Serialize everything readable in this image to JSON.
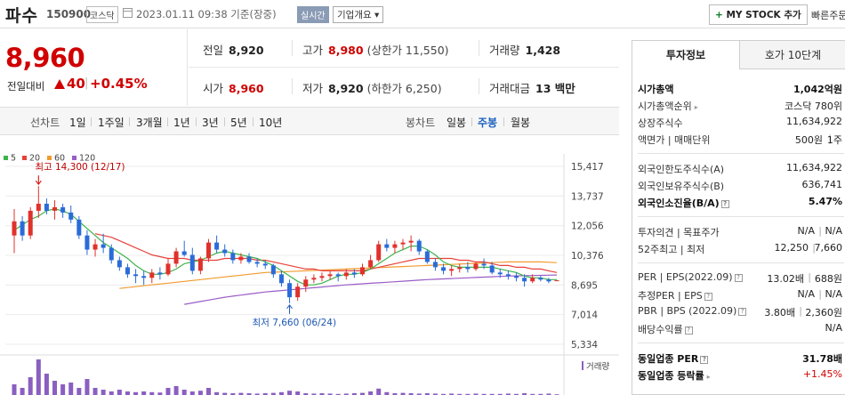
{
  "header": {
    "name": "파수",
    "code": "150900",
    "market": "코스닥",
    "datetime": "2023.01.11 09:38 기준(장중)",
    "realtime_badge": "실시간",
    "company_btn": "기업개요 ▾",
    "mystock_plus": "+",
    "mystock_label": " MY STOCK 추가",
    "quick_order": "빠른주문"
  },
  "price": {
    "current": "8,960",
    "change_label": "전일대비",
    "change_amount": "40",
    "change_sep": "|",
    "change_pct": "+0.45%",
    "direction": "up"
  },
  "quotes": {
    "prev_close_label": "전일",
    "prev_close": "8,920",
    "high_label": "고가",
    "high": "8,980",
    "high_sub": "(상한가 11,550)",
    "volume_label": "거래량",
    "volume": "1,428",
    "open_label": "시가",
    "open": "8,960",
    "low_label": "저가",
    "low": "8,920",
    "low_sub": "(하한가 6,250)",
    "amount_label": "거래대금",
    "amount": "13 백만"
  },
  "period_bar": {
    "line_chart": "선차트",
    "periods": [
      "1일",
      "1주일",
      "3개월",
      "1년",
      "3년",
      "5년",
      "10년"
    ],
    "candle_chart": "봉차트",
    "candle_types": [
      "일봉",
      "주봉",
      "월봉"
    ],
    "active_candle": "주봉"
  },
  "chart_data": {
    "type": "candlestick",
    "legend": [
      {
        "label": "5",
        "color": "#3cb44b"
      },
      {
        "label": "20",
        "color": "#e8413a"
      },
      {
        "label": "60",
        "color": "#f29b2f"
      },
      {
        "label": "120",
        "color": "#9a5cc8"
      }
    ],
    "y_ticks": [
      "15,417",
      "13,737",
      "12,056",
      "10,376",
      "8,695",
      "7,014",
      "5,334"
    ],
    "ylim": [
      5334,
      15417
    ],
    "high_annotation": "최고 14,300 (12/17)",
    "low_annotation": "최저 7,660 (06/24)",
    "volume_label": "거래량",
    "candles": [
      [
        11500,
        13000,
        10500,
        12300
      ],
      [
        12300,
        12600,
        11200,
        11500
      ],
      [
        11500,
        13100,
        11300,
        12900
      ],
      [
        12900,
        14300,
        12500,
        13300
      ],
      [
        13300,
        13600,
        12700,
        12900
      ],
      [
        12900,
        13500,
        12400,
        13100
      ],
      [
        13100,
        13300,
        12500,
        12800
      ],
      [
        12800,
        13200,
        12200,
        12400
      ],
      [
        12400,
        12600,
        11300,
        11500
      ],
      [
        11500,
        11800,
        10400,
        10700
      ],
      [
        10700,
        11300,
        10300,
        11000
      ],
      [
        11000,
        11600,
        10500,
        10800
      ],
      [
        10800,
        11000,
        9900,
        10100
      ],
      [
        10100,
        10300,
        9500,
        9700
      ],
      [
        9700,
        9900,
        9100,
        9300
      ],
      [
        9300,
        9600,
        8800,
        9200
      ],
      [
        9200,
        9500,
        8700,
        9100
      ],
      [
        9100,
        9600,
        8800,
        9400
      ],
      [
        9400,
        9700,
        9000,
        9300
      ],
      [
        9300,
        10200,
        9200,
        9900
      ],
      [
        9900,
        10800,
        9700,
        10600
      ],
      [
        10600,
        11200,
        10300,
        10400
      ],
      [
        10400,
        10800,
        9300,
        9500
      ],
      [
        9500,
        10300,
        9300,
        10200
      ],
      [
        10200,
        11300,
        10000,
        11100
      ],
      [
        11100,
        11500,
        10500,
        10700
      ],
      [
        10700,
        11000,
        10300,
        10500
      ],
      [
        10500,
        10700,
        9900,
        10100
      ],
      [
        10100,
        10500,
        9900,
        10300
      ],
      [
        10300,
        10500,
        9900,
        10000
      ],
      [
        10000,
        10200,
        9700,
        9900
      ],
      [
        9900,
        10100,
        9600,
        9800
      ],
      [
        9800,
        9900,
        9100,
        9300
      ],
      [
        9300,
        9500,
        8600,
        8800
      ],
      [
        8800,
        9000,
        7660,
        8000
      ],
      [
        8000,
        8800,
        7800,
        8600
      ],
      [
        8600,
        9200,
        8300,
        9000
      ],
      [
        9000,
        9300,
        8800,
        9100
      ],
      [
        9100,
        9400,
        8900,
        9200
      ],
      [
        9200,
        9500,
        9000,
        9300
      ],
      [
        9300,
        9400,
        8900,
        9200
      ],
      [
        9200,
        9600,
        9000,
        9400
      ],
      [
        9400,
        9600,
        9100,
        9300
      ],
      [
        9300,
        9900,
        9200,
        9700
      ],
      [
        9700,
        10400,
        9600,
        10100
      ],
      [
        10100,
        11200,
        10000,
        11000
      ],
      [
        11000,
        11300,
        10600,
        10800
      ],
      [
        10800,
        11200,
        10500,
        11000
      ],
      [
        11000,
        11300,
        10700,
        11100
      ],
      [
        11100,
        11500,
        10600,
        11200
      ],
      [
        11200,
        11300,
        10400,
        10600
      ],
      [
        10600,
        10700,
        9900,
        10000
      ],
      [
        10000,
        10200,
        9500,
        9700
      ],
      [
        9700,
        9900,
        9300,
        9500
      ],
      [
        9500,
        9800,
        9200,
        9600
      ],
      [
        9600,
        9900,
        9400,
        9700
      ],
      [
        9700,
        10000,
        9400,
        9600
      ],
      [
        9600,
        10000,
        9500,
        9900
      ],
      [
        9900,
        10200,
        9600,
        9800
      ],
      [
        9800,
        10000,
        9300,
        9400
      ],
      [
        9400,
        9600,
        9100,
        9300
      ],
      [
        9300,
        9500,
        9000,
        9200
      ],
      [
        9200,
        9400,
        8900,
        9100
      ],
      [
        9100,
        9300,
        8600,
        8900
      ],
      [
        8900,
        9300,
        8800,
        9100
      ],
      [
        9100,
        9200,
        8900,
        9000
      ],
      [
        9000,
        9100,
        8800,
        8900
      ],
      [
        8920,
        8980,
        8920,
        8960
      ]
    ],
    "ma5": [
      11800,
      12100,
      12400,
      12600,
      12900,
      13000,
      12900,
      12700,
      12300,
      11900,
      11500,
      11100,
      10800,
      10500,
      10200,
      9800,
      9500,
      9300,
      9300,
      9400,
      9600,
      9900,
      10000,
      10100,
      10300,
      10500,
      10600,
      10500,
      10400,
      10300,
      10200,
      10000,
      9800,
      9500,
      9200,
      8900,
      8700,
      8700,
      8800,
      9000,
      9200,
      9300,
      9300,
      9400,
      9600,
      9900,
      10200,
      10500,
      10700,
      10900,
      10900,
      10700,
      10400,
      10000,
      9800,
      9700,
      9700,
      9700,
      9700,
      9700,
      9600,
      9500,
      9400,
      9200,
      9100,
      9100,
      9000,
      9000
    ],
    "ma20": [
      null,
      null,
      null,
      null,
      null,
      null,
      null,
      null,
      null,
      null,
      11600,
      11500,
      11400,
      11200,
      11000,
      10800,
      10600,
      10400,
      10300,
      10200,
      10200,
      10200,
      10100,
      10100,
      10100,
      10100,
      10200,
      10200,
      10200,
      10200,
      10100,
      10100,
      10000,
      9900,
      9800,
      9700,
      9600,
      9600,
      9500,
      9500,
      9500,
      9500,
      9500,
      9500,
      9600,
      9700,
      9800,
      9900,
      10000,
      10100,
      10200,
      10200,
      10200,
      10200,
      10200,
      10100,
      10100,
      10000,
      10000,
      9900,
      9800,
      9800,
      9700,
      9700,
      9600,
      9600,
      9500,
      9400
    ],
    "ma60": [
      null,
      null,
      null,
      null,
      null,
      null,
      null,
      null,
      null,
      null,
      null,
      null,
      null,
      8500,
      8550,
      8600,
      8650,
      8700,
      8750,
      8800,
      8850,
      8900,
      8950,
      9000,
      9050,
      9100,
      9150,
      9200,
      9250,
      9300,
      9350,
      9400,
      9420,
      9440,
      9460,
      9480,
      9500,
      9520,
      9540,
      9560,
      9580,
      9600,
      9620,
      9640,
      9660,
      9680,
      9700,
      9720,
      9740,
      9760,
      9780,
      9800,
      9820,
      9840,
      9860,
      9880,
      9900,
      9920,
      9940,
      9960,
      9980,
      10000,
      10000,
      10000,
      10000,
      10000,
      9980,
      9960
    ],
    "ma120": [
      null,
      null,
      null,
      null,
      null,
      null,
      null,
      null,
      null,
      null,
      null,
      null,
      null,
      null,
      null,
      null,
      null,
      null,
      null,
      null,
      null,
      7600,
      7680,
      7760,
      7840,
      7920,
      8000,
      8060,
      8120,
      8180,
      8240,
      8300,
      8340,
      8380,
      8420,
      8460,
      8500,
      8540,
      8580,
      8620,
      8660,
      8700,
      8730,
      8760,
      8790,
      8820,
      8850,
      8880,
      8910,
      8940,
      8970,
      9000,
      9020,
      9040,
      9060,
      9080,
      9100,
      9120,
      9140,
      9160,
      9180,
      9200,
      9210,
      9220,
      9230,
      9240,
      9250,
      9260
    ],
    "volume": [
      0.3,
      0.2,
      0.5,
      1.0,
      0.6,
      0.4,
      0.3,
      0.35,
      0.2,
      0.45,
      0.2,
      0.15,
      0.1,
      0.15,
      0.1,
      0.08,
      0.1,
      0.08,
      0.07,
      0.2,
      0.25,
      0.15,
      0.1,
      0.12,
      0.2,
      0.08,
      0.06,
      0.05,
      0.06,
      0.05,
      0.04,
      0.05,
      0.06,
      0.08,
      0.12,
      0.1,
      0.05,
      0.04,
      0.05,
      0.04,
      0.03,
      0.04,
      0.05,
      0.06,
      0.1,
      0.18,
      0.08,
      0.05,
      0.06,
      0.05,
      0.04,
      0.05,
      0.04,
      0.03,
      0.04,
      0.03,
      0.03,
      0.04,
      0.03,
      0.03,
      0.03,
      0.04,
      0.03,
      0.05,
      0.03,
      0.03,
      0.04,
      0.02
    ]
  },
  "right_panel": {
    "tab_active": "투자정보",
    "tab_other": "호가 10단계",
    "market_cap_label": "시가총액",
    "market_cap": "1,042억원",
    "rank_label": "시가총액순위",
    "rank": "코스닥 780위",
    "shares_label": "상장주식수",
    "shares": "11,634,922",
    "par_label": "액면가 | 매매단위",
    "par": "500원",
    "par_sep": "|",
    "unit": "1주",
    "foreign_limit_label": "외국인한도주식수(A)",
    "foreign_limit": "11,634,922",
    "foreign_hold_label": "외국인보유주식수(B)",
    "foreign_hold": "636,741",
    "foreign_ratio_label": "외국인소진율(B/A)",
    "foreign_ratio": "5.47%",
    "opinion_label": "투자의견 | 목표주가",
    "opinion": "N/A",
    "opinion_sep": "|",
    "target": "N/A",
    "week52_label": "52주최고 | 최저",
    "week52_high": "12,250",
    "week52_sep": "|",
    "week52_low": "7,660",
    "per_label": "PER | EPS(2022.09)",
    "per": "13.02배",
    "per_sep": "|",
    "eps": "688원",
    "est_per_label": "추정PER | EPS",
    "est_per": "N/A",
    "est_sep": "|",
    "est_eps": "N/A",
    "pbr_label": "PBR | BPS (2022.09)",
    "pbr": "3.80배",
    "pbr_sep": "|",
    "bps": "2,360원",
    "dividend_label": "배당수익률",
    "dividend": "N/A",
    "sector_per_label": "동일업종 PER",
    "sector_per": "31.78배",
    "sector_rate_label": "동일업종 등락률",
    "sector_rate": "+1.45%"
  }
}
